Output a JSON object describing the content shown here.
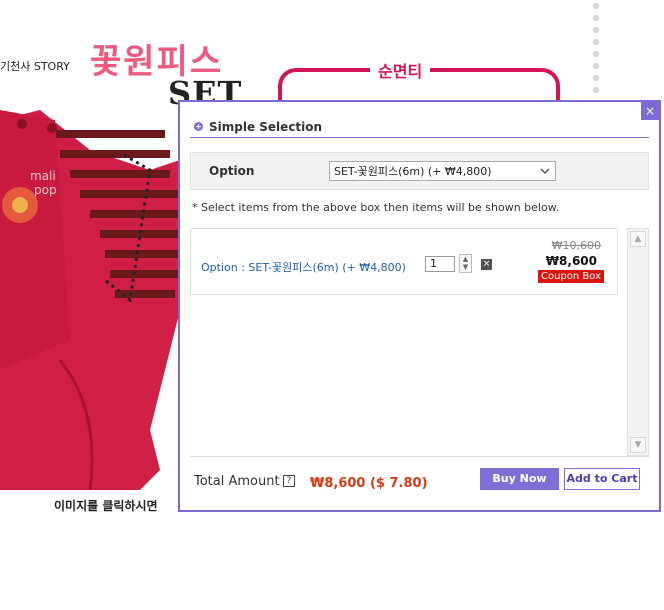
{
  "background": {
    "story_text": "기천사 STORY",
    "title_text": "꽃원피스",
    "set_text": "SET",
    "banner_text": "순면티",
    "bottom_text": "이미지를 클릭하시면"
  },
  "popup": {
    "close_glyph": "×",
    "title": "Simple Selection",
    "option_label": "Option",
    "option_selected": "SET-꽃원피스(6m) (+ ₩4,800)",
    "hint": "* Select items from the above box then items will be shown below.",
    "items": [
      {
        "name": "Option : SET-꽃원피스(6m) (+ ₩4,800)",
        "qty": "1",
        "original_price": "₩10,600",
        "price": "₩8,600",
        "coupon_label": "Coupon Box"
      }
    ],
    "total_label": "Total Amount",
    "help_glyph": "?",
    "total_value": "₩8,600 ($ 7.80)",
    "buy_now": "Buy Now",
    "add_to_cart": "Add to Cart"
  },
  "colors": {
    "accent": "#7c6bd6",
    "price_red": "#d63a10",
    "coupon_red": "#d8150f",
    "link_blue": "#1e5fa8"
  }
}
